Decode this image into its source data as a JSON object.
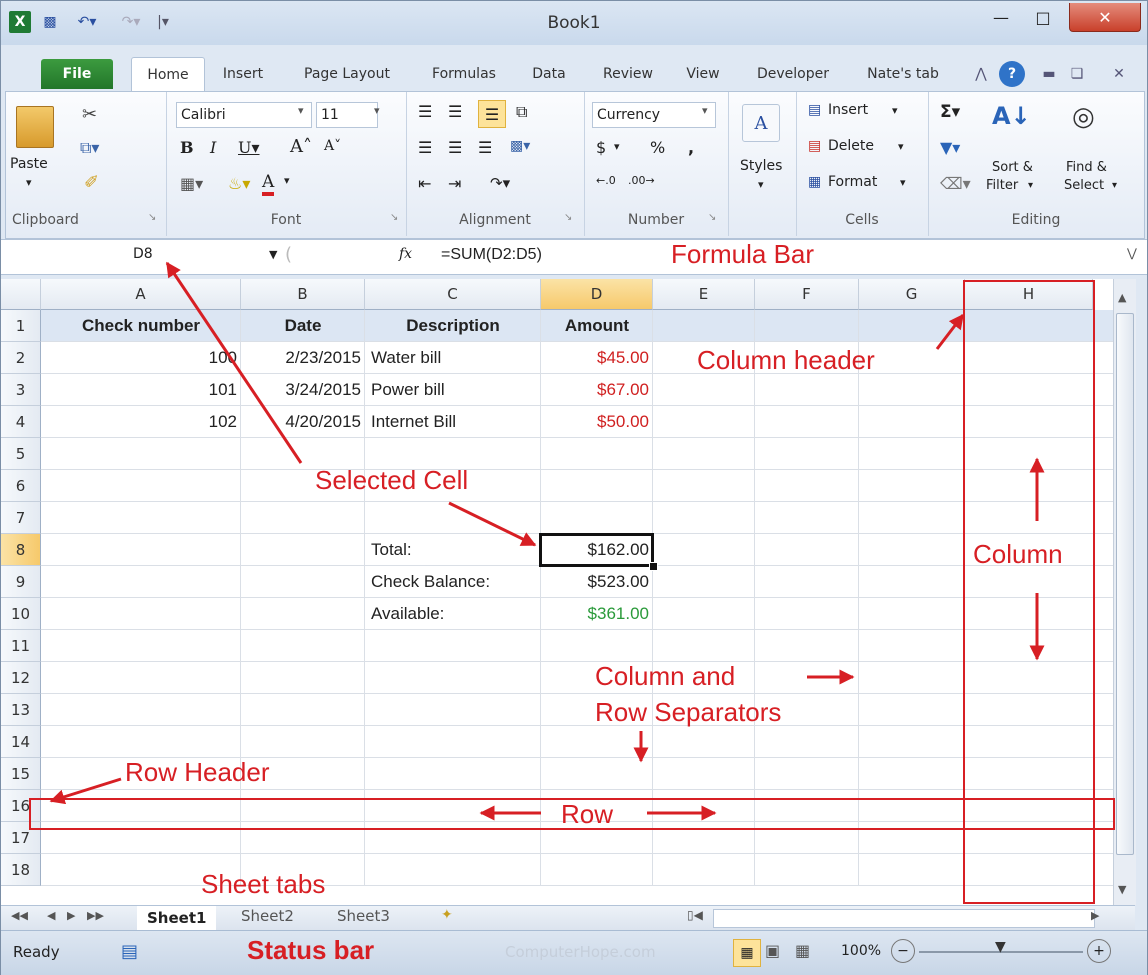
{
  "title": "Book1",
  "tabs": [
    "File",
    "Home",
    "Insert",
    "Page Layout",
    "Formulas",
    "Data",
    "Review",
    "View",
    "Developer",
    "Nate's tab"
  ],
  "ribbon": {
    "clipboard": {
      "paste": "Paste",
      "label": "Clipboard"
    },
    "font": {
      "name": "Calibri",
      "size": "11",
      "label": "Font"
    },
    "alignment": {
      "label": "Alignment"
    },
    "number": {
      "format": "Currency",
      "dollar": "$",
      "percent": "%",
      "comma": ",",
      "label": "Number"
    },
    "styles": {
      "label": "Styles"
    },
    "cells": {
      "insert": "Insert",
      "delete": "Delete",
      "format": "Format",
      "label": "Cells"
    },
    "editing": {
      "sort": "Sort &",
      "filter": "Filter",
      "find": "Find &",
      "select": "Select",
      "label": "Editing"
    }
  },
  "formula_bar": {
    "name_box": "D8",
    "fx": "fx",
    "formula": "=SUM(D2:D5)"
  },
  "columns": [
    "A",
    "B",
    "C",
    "D",
    "E",
    "F",
    "G",
    "H"
  ],
  "rows": [
    "1",
    "2",
    "3",
    "4",
    "5",
    "6",
    "7",
    "8",
    "9",
    "10",
    "11",
    "12",
    "13",
    "14",
    "15",
    "16",
    "17",
    "18"
  ],
  "cells": {
    "A1": "Check number",
    "B1": "Date",
    "C1": "Description",
    "D1": "Amount",
    "A2": "100",
    "B2": "2/23/2015",
    "C2": "Water bill",
    "D2": "$45.00",
    "A3": "101",
    "B3": "3/24/2015",
    "C3": "Power bill",
    "D3": "$67.00",
    "A4": "102",
    "B4": "4/20/2015",
    "C4": "Internet Bill",
    "D4": "$50.00",
    "C8": "Total:",
    "D8": "$162.00",
    "C9": "Check Balance:",
    "D9": "$523.00",
    "C10": "Available:",
    "D10": "$361.00"
  },
  "sheets": [
    "Sheet1",
    "Sheet2",
    "Sheet3"
  ],
  "status": {
    "ready": "Ready",
    "zoom": "100%",
    "watermark": "ComputerHope.com"
  },
  "annotations": {
    "formula_bar": "Formula Bar",
    "column_header": "Column header",
    "selected_cell": "Selected Cell",
    "column": "Column",
    "separators_1": "Column and",
    "separators_2": "Row Separators",
    "row_header": "Row Header",
    "row": "Row",
    "sheet_tabs": "Sheet tabs",
    "status_bar": "Status bar"
  },
  "colors": {
    "annotation": "#d71f24",
    "selected_header": "#f6c96b",
    "file_tab": "#2b8a32"
  }
}
